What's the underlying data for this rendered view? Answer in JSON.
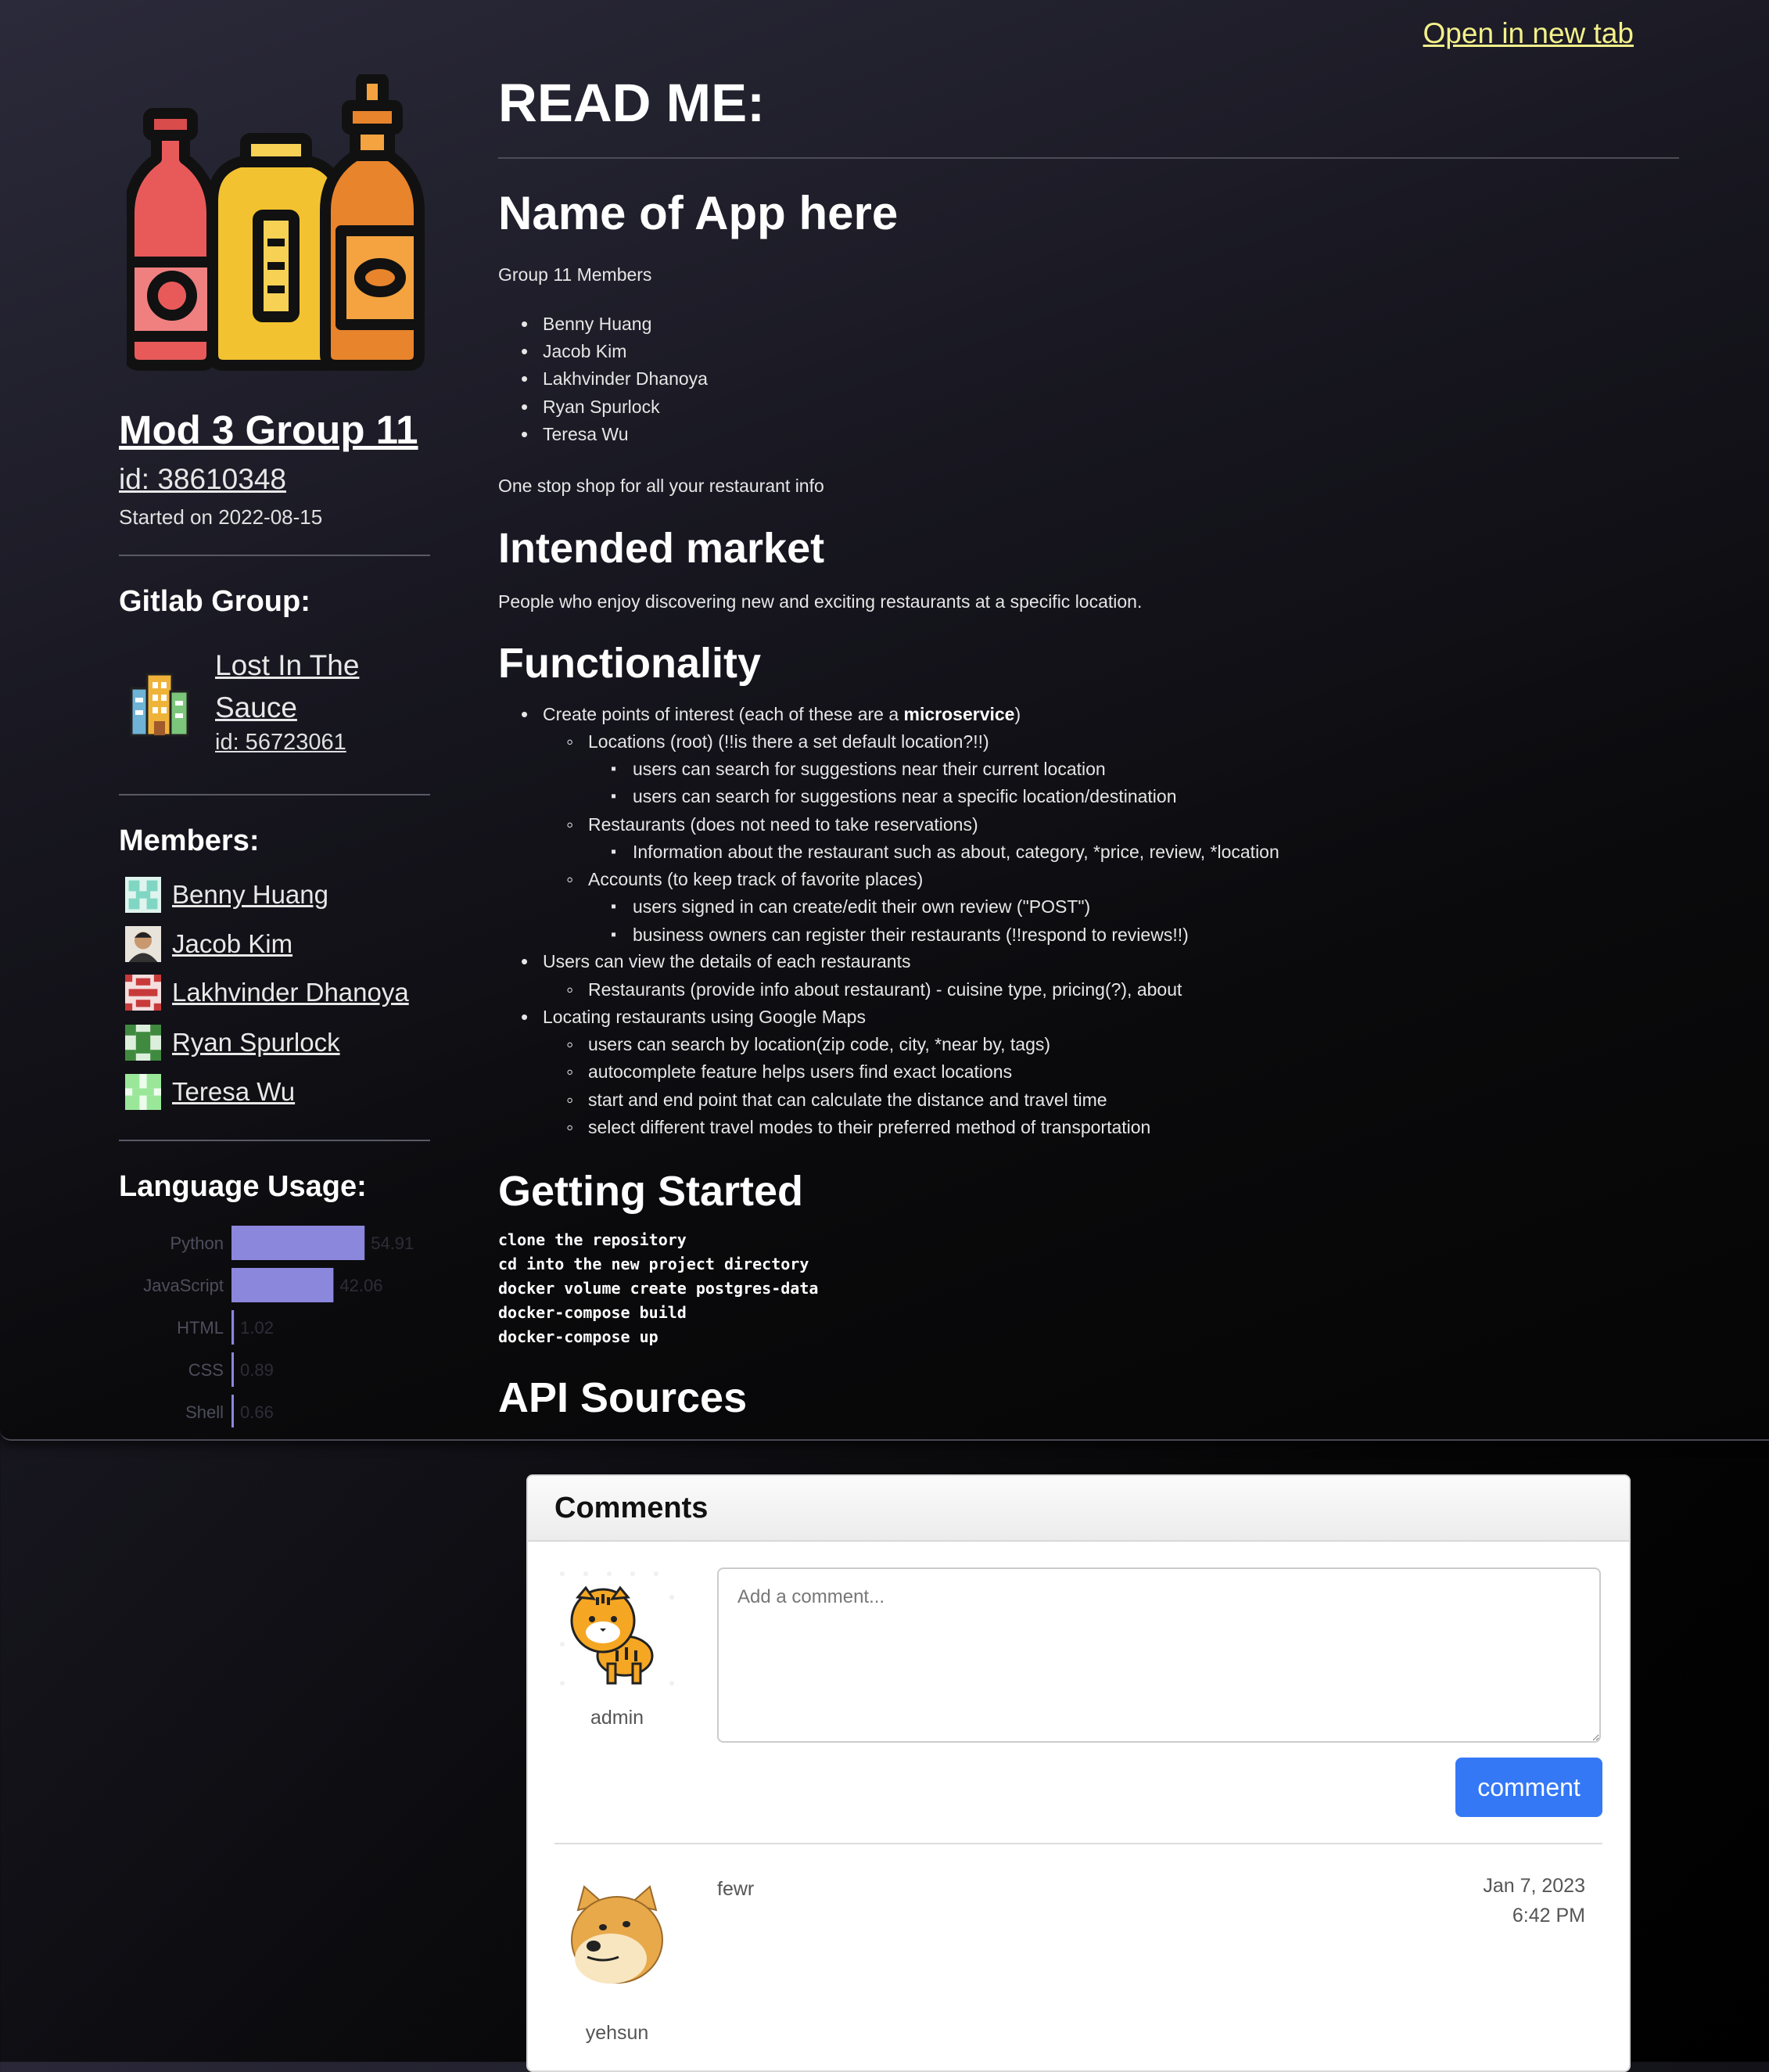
{
  "header": {
    "open_new_tab": "Open in new tab"
  },
  "sidebar": {
    "project_title": "Mod 3 Group 11",
    "project_id": "id: 38610348",
    "started": "Started on 2022-08-15",
    "gitlab_heading": "Gitlab Group:",
    "group_name": "Lost In The Sauce",
    "group_id": "id: 56723061",
    "members_heading": "Members:",
    "members": [
      {
        "name": "Benny Huang",
        "avatar_color": "#7fd6c3"
      },
      {
        "name": "Jacob Kim",
        "avatar_color": "#b08a6a"
      },
      {
        "name": "Lakhvinder Dhanoya",
        "avatar_color": "#c83a3a"
      },
      {
        "name": "Ryan Spurlock",
        "avatar_color": "#3f8a3f"
      },
      {
        "name": "Teresa Wu",
        "avatar_color": "#9ae79a"
      }
    ],
    "language_heading": "Language Usage:"
  },
  "chart_data": {
    "type": "bar",
    "orientation": "horizontal",
    "categories": [
      "Python",
      "JavaScript",
      "HTML",
      "CSS",
      "Shell"
    ],
    "values": [
      54.91,
      42.06,
      1.02,
      0.89,
      0.66
    ],
    "xlim": [
      0,
      100
    ],
    "bar_color": "#8b87dc"
  },
  "readme": {
    "heading": "READ ME:",
    "app_name": "Name of App here",
    "group_members_label": "Group 11 Members",
    "members": [
      "Benny Huang",
      "Jacob Kim",
      "Lakhvinder Dhanoya",
      "Ryan Spurlock",
      "Teresa Wu"
    ],
    "tagline": "One stop shop for all your restaurant info",
    "market_heading": "Intended market",
    "market_text": "People who enjoy discovering new and exciting restaurants at a specific location.",
    "func_heading": "Functionality",
    "func": {
      "create_pre": "Create points of interest (each of these are a ",
      "create_bold": "microservice",
      "create_post": ")",
      "locations": "Locations (root) (!!is there a set default location?!!)",
      "loc_1": "users can search for suggestions near their current location",
      "loc_2": "users can search for suggestions near a specific location/destination",
      "restaurants": "Restaurants (does not need to take reservations)",
      "rest_1": "Information about the restaurant such as about, category, *price, review, *location",
      "accounts": "Accounts (to keep track of favorite places)",
      "acc_1": "users signed in can create/edit their own review (\"POST\")",
      "acc_2": "business owners can register their restaurants (!!respond to reviews!!)",
      "view": "Users can view the details of each restaurants",
      "view_1": "Restaurants (provide info about restaurant) - cuisine type, pricing(?), about",
      "maps": "Locating restaurants using Google Maps",
      "maps_1": "users can search by location(zip code, city, *near by, tags)",
      "maps_2": "autocomplete feature helps users find exact locations",
      "maps_3": "start and end point that can calculate the distance and travel time",
      "maps_4": "select different travel modes to their preferred method of transportation"
    },
    "getting_started_heading": "Getting Started",
    "code": [
      "clone the repository",
      "cd into the new project directory",
      "docker volume create postgres-data",
      "docker-compose build",
      "docker-compose up"
    ],
    "api_heading": "API Sources"
  },
  "comments": {
    "title": "Comments",
    "current_user": "admin",
    "placeholder": "Add a comment...",
    "submit_label": "comment",
    "items": [
      {
        "user": "yehsun",
        "text": "fewr",
        "date": "Jan 7, 2023",
        "time": "6:42 PM"
      }
    ]
  }
}
